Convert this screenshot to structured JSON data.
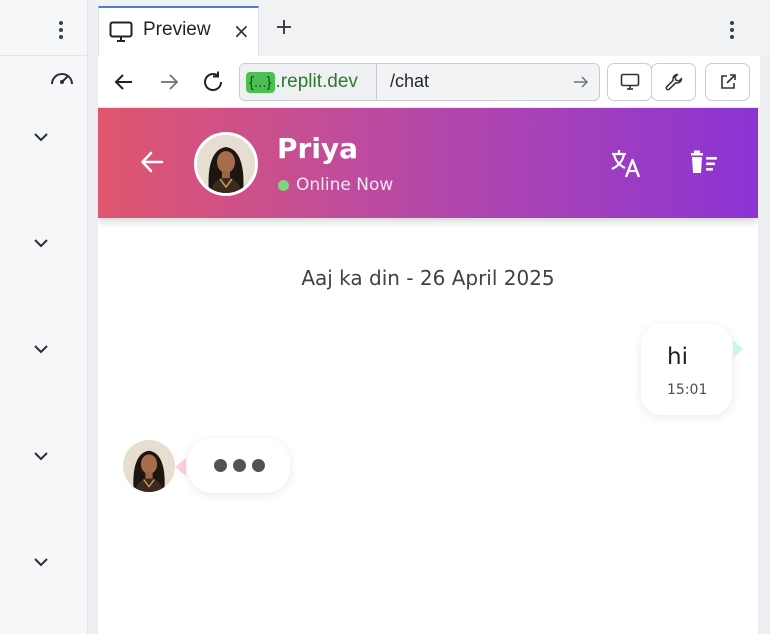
{
  "browser": {
    "tab_title": "Preview",
    "tab_close": "×",
    "url_badge": "{...}",
    "url_domain": ".replit.dev",
    "url_path": "/chat",
    "tab_accent_color": "#4c7bd9"
  },
  "chat": {
    "contact_name": "Priya",
    "status_text": "Online Now",
    "date_label": "Aaj ka din - 26 April 2025",
    "messages": [
      {
        "direction": "outgoing",
        "text": "hi",
        "time": "15:01"
      }
    ],
    "typing_indicator": true,
    "header_gradient": [
      "#e0566e",
      "#b94aa4",
      "#8b34d4"
    ],
    "status_color": "#7ed67e"
  },
  "icons": {
    "left_panel": [
      "kebab-menu-icon",
      "gauge-icon",
      "chevron-down-icon"
    ],
    "nav": [
      "back-arrow-icon",
      "forward-arrow-icon",
      "reload-icon",
      "go-arrow-icon"
    ],
    "tools": [
      "monitor-icon",
      "wrench-icon",
      "open-external-icon"
    ],
    "chat_header": [
      "back-arrow-icon",
      "translate-icon",
      "clear-chat-icon"
    ]
  }
}
